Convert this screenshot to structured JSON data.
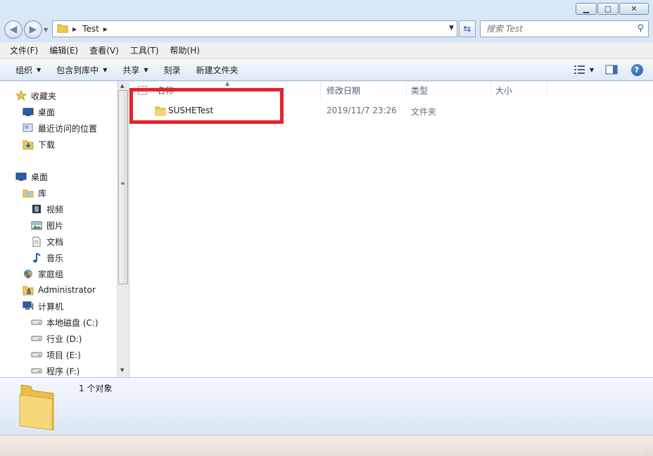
{
  "window": {
    "min_label": "▁",
    "max_label": "▢",
    "close_label": "✕"
  },
  "address": {
    "crumb": "Test",
    "search_placeholder": "搜索 Test"
  },
  "menu": [
    "文件(F)",
    "编辑(E)",
    "查看(V)",
    "工具(T)",
    "帮助(H)"
  ],
  "toolbar": {
    "organize": "组织",
    "include_library": "包含到库中",
    "share": "共享",
    "burn": "刻录",
    "new_folder": "新建文件夹"
  },
  "nav": {
    "favorites": "收藏夹",
    "desktop_fav": "桌面",
    "recent": "最近访问的位置",
    "downloads": "下载",
    "desktop": "桌面",
    "libraries": "库",
    "videos": "视频",
    "pictures": "图片",
    "documents": "文档",
    "music": "音乐",
    "homegroup": "家庭组",
    "admin": "Administrator",
    "computer": "计算机",
    "drive_c": "本地磁盘 (C:)",
    "drive_d": "行业 (D:)",
    "drive_e": "项目 (E:)",
    "drive_f": "程序 (F:)"
  },
  "columns": {
    "name": "名称",
    "modified": "修改日期",
    "type": "类型",
    "size": "大小"
  },
  "files": [
    {
      "name": "SUSHETest",
      "modified": "2019/11/7 23:26",
      "type": "文件夹",
      "size": ""
    }
  ],
  "details": {
    "count": "1 个对象"
  },
  "colors": {
    "highlight": "#e8232a",
    "folder": "#f2c94c"
  }
}
